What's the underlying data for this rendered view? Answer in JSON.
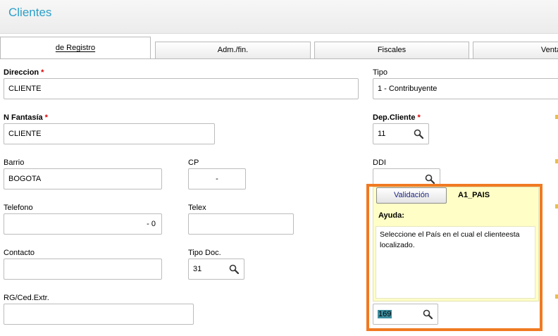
{
  "window": {
    "title": "Clientes"
  },
  "tabs": [
    {
      "label": "de Registro",
      "hotkey": "d"
    },
    {
      "label": "Adm./fin.",
      "hotkey": "A"
    },
    {
      "label": "Fiscales",
      "hotkey": "F"
    },
    {
      "label": "Venta",
      "hotkey": ""
    }
  ],
  "form": {
    "direccion": {
      "label": "Direccion",
      "required": "*",
      "value": "CLIENTE"
    },
    "tipo": {
      "label": "Tipo",
      "value": "1 - Contribuyente"
    },
    "n_fantasia": {
      "label": "N Fantasía",
      "required": "*",
      "value": "CLIENTE"
    },
    "dep_cliente": {
      "label": "Dep.Cliente",
      "required": "*",
      "value": "11"
    },
    "barrio": {
      "label": "Barrio",
      "value": "BOGOTA"
    },
    "cp": {
      "label": "CP",
      "value": "-"
    },
    "ddi": {
      "label": "DDI",
      "value": ""
    },
    "telefono": {
      "label": "Telefono",
      "value": "-  0"
    },
    "telex": {
      "label": "Telex",
      "value": ""
    },
    "contacto": {
      "label": "Contacto",
      "value": ""
    },
    "tipo_doc": {
      "label": "Tipo Doc.",
      "value": "31"
    },
    "rg_ced": {
      "label": "RG/Ced.Extr.",
      "value": ""
    },
    "pais": {
      "value": "169"
    }
  },
  "tooltip": {
    "button_label": "Validación",
    "field_code": "A1_PAIS",
    "help_title": "Ayuda:",
    "help_text": "Seleccione el País en el cual el clienteesta localizado."
  },
  "colors": {
    "title": "#2b9fc9",
    "required": "#dd0000",
    "frame": "#f07a22",
    "help_bg": "#fefec6",
    "selection": "#3e8ea0"
  }
}
